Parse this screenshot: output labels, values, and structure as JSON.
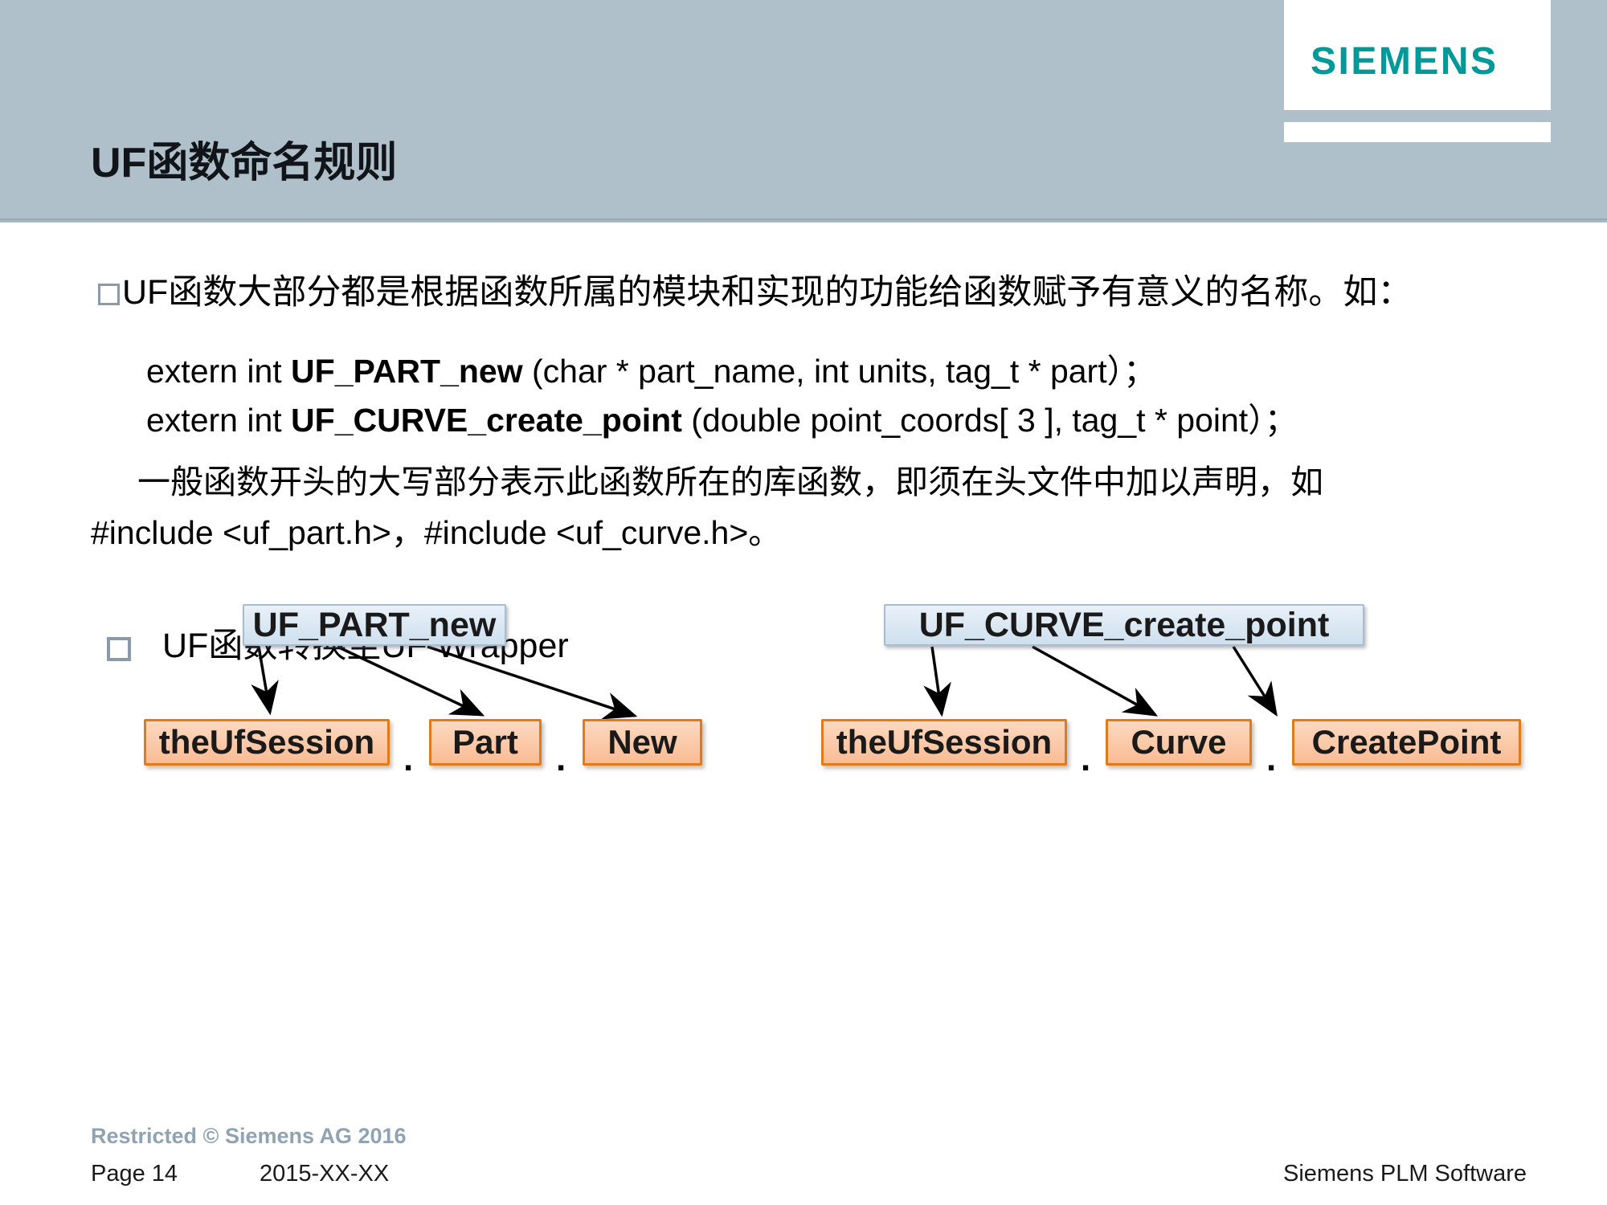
{
  "slide": {
    "title": "UF函数命名规则",
    "logo": {
      "wordmark": "SIEMENS"
    }
  },
  "body": {
    "bullet1": {
      "marker": "hollow-square-bullet",
      "text": "UF函数大部分都是根据函数所属的模块和实现的功能给函数赋予有意义的名称。如："
    },
    "code_lines": [
      {
        "prefix": "extern int ",
        "name": "UF_PART_new",
        "suffix": " (char * part_name, int units, tag_t *   part）；"
      },
      {
        "prefix": "extern int ",
        "name": "UF_CURVE_create_point",
        "suffix": " (double point_coords[ 3 ], tag_t * point）；"
      }
    ],
    "paragraph": {
      "line1": "一般函数开头的大写部分表示此函数所在的库函数，即须在头文件中加以声明，如",
      "line2": "#include <uf_part.h>，#include <uf_curve.h>。"
    },
    "bullet2": {
      "marker": "hollow-square-bullet",
      "text": "UF函数转换至UF Wrapper"
    }
  },
  "diagram": {
    "groups": [
      {
        "id": "part-group",
        "source_label": "UF_PART_new",
        "targets": [
          "theUfSession",
          "Part",
          "New"
        ],
        "separators": [
          ".",
          "."
        ]
      },
      {
        "id": "curve-group",
        "source_label": "UF_CURVE_create_point",
        "targets": [
          "theUfSession",
          "Curve",
          "CreatePoint"
        ],
        "separators": [
          ".",
          "."
        ]
      }
    ],
    "colors": {
      "source_box_fill": "#dbe8f3",
      "source_box_border": "#a9bcd0",
      "target_box_fill": "#fbc9a8",
      "target_box_border": "#e07b19",
      "arrow": "#000000"
    }
  },
  "footer": {
    "restricted": "Restricted © Siemens AG 2016",
    "page": "Page 14",
    "date": "2015-XX-XX",
    "brand": "Siemens PLM Software"
  },
  "theme": {
    "header_band": "#b0c0cb",
    "siemens_teal": "#009999",
    "footer_muted": "#8fa3b3"
  }
}
